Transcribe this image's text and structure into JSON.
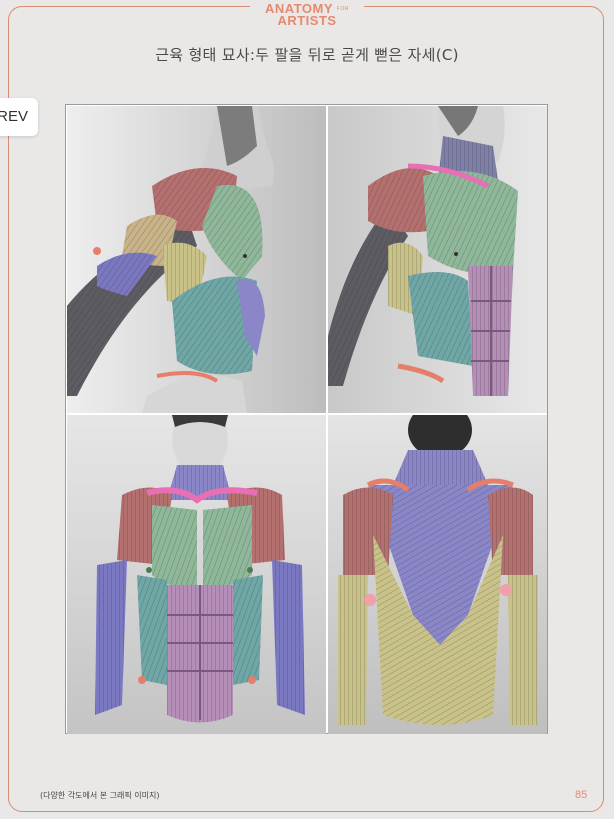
{
  "header": {
    "logo_line1": "ANATOMY",
    "logo_for": "FOR",
    "logo_line2": "ARTISTS"
  },
  "page_title": "근육 형태 묘사:두 팔을 뒤로 곧게 뻗은 자세(C)",
  "nav": {
    "prev_label": "REV"
  },
  "figure": {
    "panels": [
      "side-view",
      "three-quarter-front-view",
      "front-view",
      "back-view"
    ]
  },
  "colors": {
    "accent": "#e48a70",
    "deltoid": "#b4706e",
    "pectoral": "#8fb79a",
    "abdominal": "#b58fb7",
    "serratus": "#7b78c2",
    "back": "#c9c38a",
    "trapezius": "#8a86c8",
    "bone": "#e57f6b",
    "clavicle": "#e86fb4"
  },
  "footer": {
    "caption": "(다양한 각도에서 본 그래픽 이미지)",
    "page_number": "85"
  }
}
